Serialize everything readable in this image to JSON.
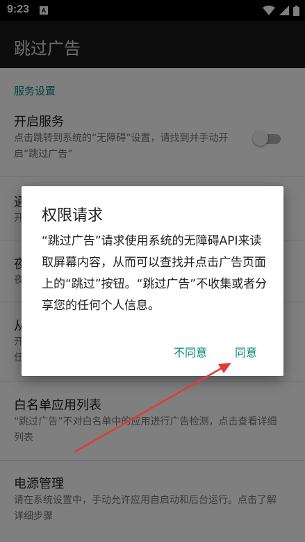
{
  "status_bar": {
    "time": "9:23",
    "app_icon_letter": "A"
  },
  "app_bar": {
    "title": "跳过广告"
  },
  "settings": {
    "section_title": "服务设置",
    "items": [
      {
        "title": "开启服务",
        "summary": "点击跳转到系统的“无障碍”设置，请找到并手动开启“跳过广告”"
      },
      {
        "title": "通",
        "summary": "开"
      },
      {
        "title": "夜",
        "summary": "夜"
      },
      {
        "title": "从",
        "summary": "开 任"
      },
      {
        "title": "白名单应用列表",
        "summary": "“跳过广告”不对白名单中的应用进行广告检测，点击查看详细列表"
      },
      {
        "title": "电源管理",
        "summary": "请在系统设置中，手动允许应用自启动和后台运行。点击了解详细步骤"
      }
    ],
    "service_switch_on": false
  },
  "dialog": {
    "title": "权限请求",
    "message": "“跳过广告”请求使用系统的无障碍API来读取屏幕内容，从而可以查找并点击广告页面上的“跳过”按钮。“跳过广告”不收集或者分享您的任何个人信息。",
    "disagree_label": "不同意",
    "agree_label": "同意"
  },
  "colors": {
    "accent": "#00897b",
    "annotation_arrow": "#e53935"
  }
}
